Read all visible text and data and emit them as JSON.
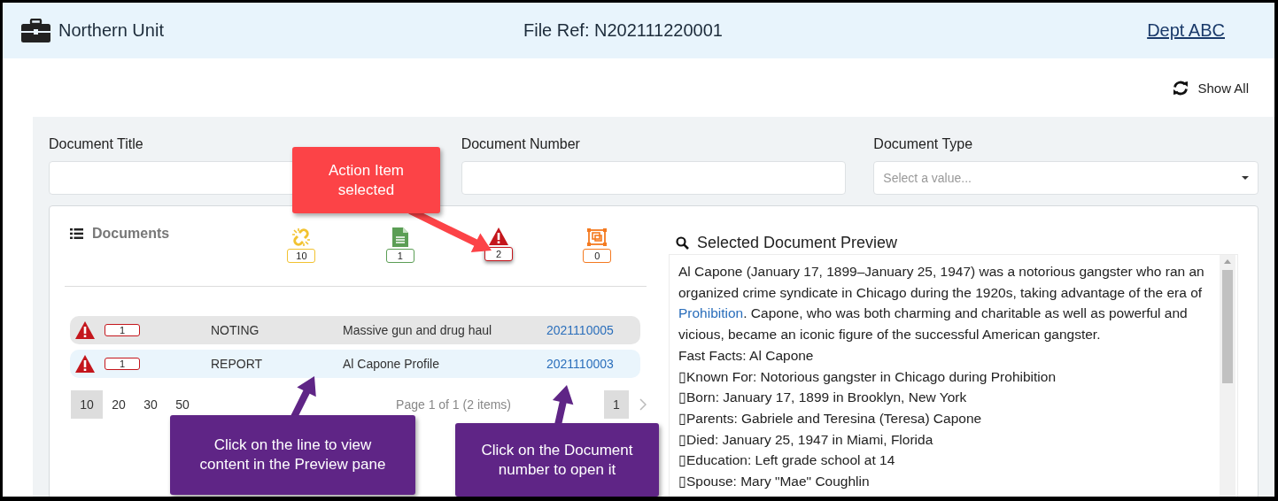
{
  "header": {
    "unit": "Northern Unit",
    "file_ref": "File Ref: N202111220001",
    "dept": "Dept ABC"
  },
  "toolbar": {
    "show_all": "Show All"
  },
  "filters": [
    {
      "label": "Document Title",
      "kind": "text"
    },
    {
      "label": "Document Number",
      "kind": "text"
    },
    {
      "label": "Document Type",
      "kind": "select",
      "placeholder": "Select a value..."
    }
  ],
  "documents": {
    "title": "Documents",
    "counters": [
      {
        "kind": "link",
        "count": "10",
        "color": "#f2c230",
        "selected": false
      },
      {
        "kind": "doc",
        "count": "1",
        "color": "#5b9e55",
        "selected": false
      },
      {
        "kind": "alert",
        "count": "2",
        "color": "#c4161c",
        "selected": true
      },
      {
        "kind": "frame",
        "count": "0",
        "color": "#f47a20",
        "selected": false
      }
    ],
    "rows": [
      {
        "count": "1",
        "type": "NOTING",
        "title": "Massive gun and drug haul",
        "number": "2021110005",
        "selected": false
      },
      {
        "count": "1",
        "type": "REPORT",
        "title": "Al Capone Profile",
        "number": "2021110003",
        "selected": true
      }
    ],
    "page_sizes": [
      {
        "label": "10",
        "selected": true
      },
      {
        "label": "20",
        "selected": false
      },
      {
        "label": "30",
        "selected": false
      },
      {
        "label": "50",
        "selected": false
      }
    ],
    "page_info": "Page 1 of 1 (2 items)",
    "pages": [
      {
        "label": "1",
        "selected": true
      }
    ]
  },
  "preview": {
    "title": "Selected Document Preview",
    "paragraph": [
      {
        "text": "Al Capone (January 17, 1899–January 25, 1947) was a notorious gangster who ran an organized crime syndicate in Chicago during the 1920s, taking advantage of the era of "
      },
      {
        "text": "Prohibition",
        "kind": "link"
      },
      {
        "text": ". Capone, who was both charming and charitable as well as powerful and vicious, became an iconic figure of the successful American gangster."
      }
    ],
    "lines": [
      "Fast Facts: Al Capone",
      "▯Known For: Notorious gangster in Chicago during Prohibition",
      "▯Born: January 17, 1899 in Brooklyn, New York",
      "▯Parents: Gabriele and Teresina (Teresa) Capone",
      "▯Died: January 25, 1947 in Miami, Florida",
      "▯Education: Left grade school at 14",
      "▯Spouse: Mary \"Mae\" Coughlin"
    ]
  },
  "callouts": [
    {
      "text": "Action Item selected",
      "color": "#fc4347"
    },
    {
      "text": "Click on the line to view content in the Preview pane",
      "color": "#5f2586"
    },
    {
      "text": "Click on the Document number to open it",
      "color": "#5f2586"
    }
  ]
}
